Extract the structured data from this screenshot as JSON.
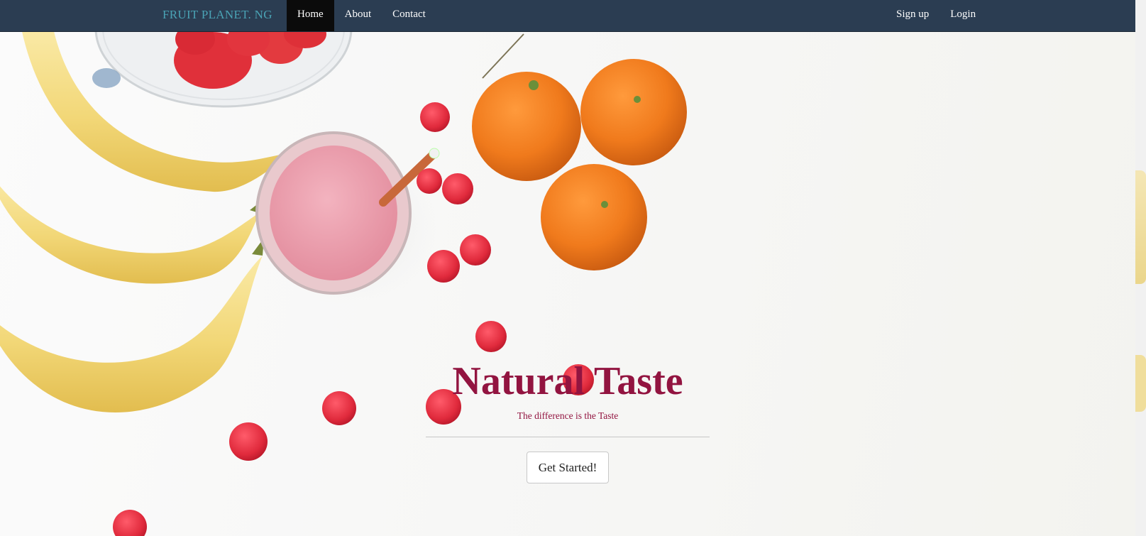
{
  "navbar": {
    "brand": "FRUIT PLANET. NG",
    "left_links": [
      {
        "label": "Home",
        "active": true
      },
      {
        "label": "About",
        "active": false
      },
      {
        "label": "Contact",
        "active": false
      }
    ],
    "right_links": [
      {
        "label": "Sign up"
      },
      {
        "label": "Login"
      }
    ]
  },
  "hero": {
    "title": "Natural Taste",
    "subtitle": "The difference is the Taste",
    "cta_label": "Get Started!"
  },
  "colors": {
    "navbar_bg": "#2b3d52",
    "brand": "#4aa3b5",
    "active_link_bg": "#0b0b0b",
    "title": "#921440"
  }
}
